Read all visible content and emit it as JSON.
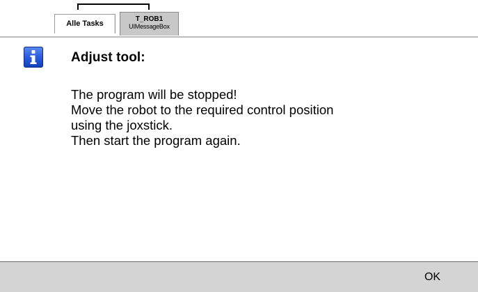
{
  "tabs": [
    {
      "label": "Alle Tasks"
    },
    {
      "title": "T_ROB1",
      "subtitle": "UIMessageBox"
    }
  ],
  "message": {
    "icon": "info-icon",
    "title": "Adjust tool:",
    "lines": [
      "The program will be stopped!",
      "Move the robot to the required control position",
      "using the joxstick.",
      "Then start the program again."
    ]
  },
  "buttons": {
    "ok_label": "OK"
  },
  "colors": {
    "icon_blue": "#2f5fe0",
    "button_bar": "#d4d4d4",
    "active_tab": "#c8c8c8"
  }
}
